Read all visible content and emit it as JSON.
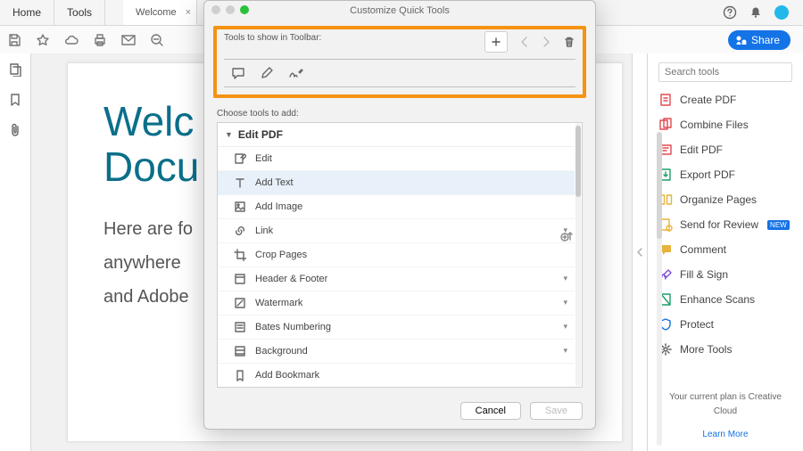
{
  "tabs": {
    "home": "Home",
    "tools": "Tools",
    "doc": "Welcome"
  },
  "topbar": {
    "help": "?",
    "bell": "●"
  },
  "share_label": "Share",
  "doc": {
    "h1": "Welc",
    "h2": "Docu",
    "p1": "Here are fo",
    "p2": "anywhere ",
    "p3": "and Adobe"
  },
  "right": {
    "search_ph": "Search tools",
    "items": [
      {
        "label": "Create PDF",
        "color": "#E34850"
      },
      {
        "label": "Combine Files",
        "color": "#E34850"
      },
      {
        "label": "Edit PDF",
        "color": "#E34850"
      },
      {
        "label": "Export PDF",
        "color": "#1E9E6A"
      },
      {
        "label": "Organize Pages",
        "color": "#E6B43C"
      },
      {
        "label": "Send for Review",
        "color": "#E6B43C",
        "badge": "NEW"
      },
      {
        "label": "Comment",
        "color": "#E6B43C"
      },
      {
        "label": "Fill & Sign",
        "color": "#7A4DD8"
      },
      {
        "label": "Enhance Scans",
        "color": "#1E9E6A"
      },
      {
        "label": "Protect",
        "color": "#1473E6"
      },
      {
        "label": "More Tools",
        "color": "#555"
      }
    ],
    "plan": "Your current plan is Creative Cloud",
    "learn": "Learn More"
  },
  "dialog": {
    "title": "Customize Quick Tools",
    "tools_label": "Tools to show in Toolbar:",
    "choose_label": "Choose tools to add:",
    "section": "Edit PDF",
    "rows": [
      {
        "label": "Edit",
        "expand": false
      },
      {
        "label": "Add Text",
        "expand": false,
        "selected": true
      },
      {
        "label": "Add Image",
        "expand": false
      },
      {
        "label": "Link",
        "expand": true
      },
      {
        "label": "Crop Pages",
        "expand": false
      },
      {
        "label": "Header & Footer",
        "expand": true
      },
      {
        "label": "Watermark",
        "expand": true
      },
      {
        "label": "Bates Numbering",
        "expand": true
      },
      {
        "label": "Background",
        "expand": true
      },
      {
        "label": "Add Bookmark",
        "expand": false
      }
    ],
    "cancel": "Cancel",
    "save": "Save"
  }
}
